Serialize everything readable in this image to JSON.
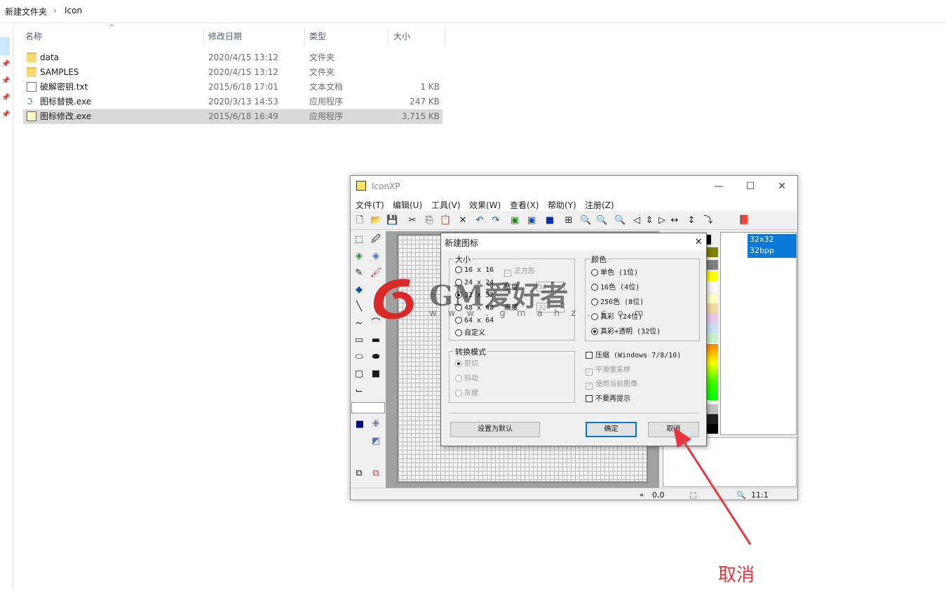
{
  "explorer": {
    "breadcrumb": [
      "新建文件夹",
      "Icon"
    ],
    "columns": [
      "名称",
      "修改日期",
      "类型",
      "大小"
    ],
    "files": [
      {
        "name": "data",
        "date": "2020/4/15 13:12",
        "type": "文件夹",
        "size": "",
        "icon": "folder-icon"
      },
      {
        "name": "SAMPLES",
        "date": "2020/4/15 13:12",
        "type": "文件夹",
        "size": "",
        "icon": "folder-icon"
      },
      {
        "name": "破解密钥.txt",
        "date": "2015/6/18 17:01",
        "type": "文本文档",
        "size": "1 KB",
        "icon": "text-file-icon"
      },
      {
        "name": "图标替换.exe",
        "date": "2020/3/13 14:53",
        "type": "应用程序",
        "size": "247 KB",
        "icon": "exe-icon"
      },
      {
        "name": "图标修改.exe",
        "date": "2015/6/18 16:49",
        "type": "应用程序",
        "size": "3,715 KB",
        "icon": "exe-icon",
        "selected": true
      }
    ]
  },
  "iconxp": {
    "title": "IconXP",
    "menu": [
      "文件(T)",
      "编辑(U)",
      "工具(V)",
      "效果(W)",
      "查看(X)",
      "帮助(Y)",
      "注册(Z)"
    ],
    "list_item": [
      "32x32",
      "32bpp"
    ],
    "status": {
      "coords": "0,0",
      "zoom": "11:1"
    }
  },
  "dialog": {
    "title": "新建图标",
    "size_group": {
      "label": "大小",
      "options": [
        "16 x 16",
        "24 x 24",
        "32 x 32",
        "48 x 48",
        "64 x 64",
        "自定义"
      ],
      "selected": 2,
      "square_label": "正方形",
      "width_label": "宽度",
      "height_label": "高度",
      "width_value": "32",
      "height_value": "32"
    },
    "color_group": {
      "label": "颜色",
      "options": [
        "单色 (1位)",
        "16色 (4位)",
        "256色 (8位)",
        "真彩 (24位)",
        "真彩+透明 (32位)"
      ],
      "selected": 4
    },
    "convert_group": {
      "label": "转换模式",
      "options": [
        "剪切",
        "抖动",
        "灰度"
      ],
      "selected": 0
    },
    "checks": [
      {
        "label": "压缩 (Windows 7/8/10)",
        "checked": false,
        "disabled": false
      },
      {
        "label": "平滑重采样",
        "checked": true,
        "disabled": true
      },
      {
        "label": "使用当前图像",
        "checked": true,
        "disabled": true
      },
      {
        "label": "不要再提示",
        "checked": false,
        "disabled": false
      }
    ],
    "buttons": {
      "default": "设置为默认",
      "ok": "确定",
      "cancel": "取消"
    }
  },
  "watermark": {
    "brand": "GM爱好者",
    "url": "w w w . g m a h z . c o m"
  },
  "annotation": {
    "text": "取消",
    "color": "#e8353c"
  },
  "colors": {
    "selection": "#0a78d7",
    "explorer_selected_row": "#d9d9d9"
  }
}
